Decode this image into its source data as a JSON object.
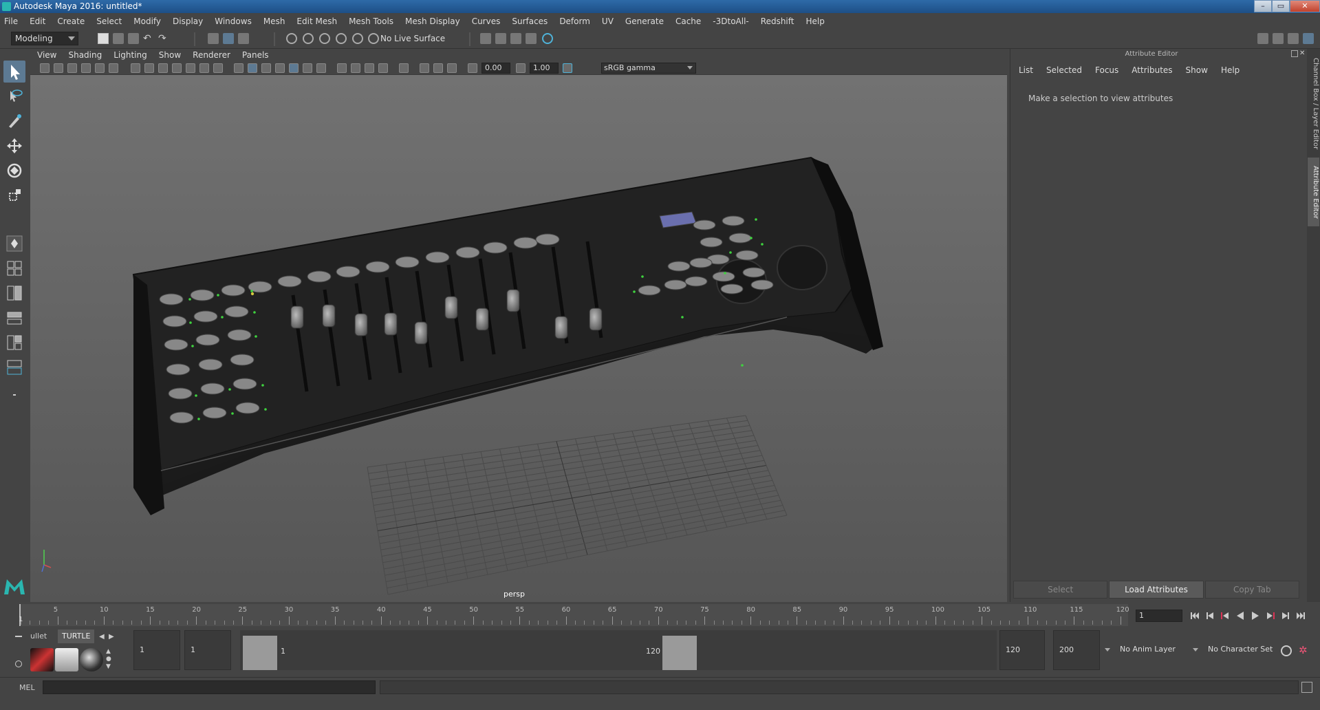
{
  "window": {
    "title": "Autodesk Maya 2016: untitled*"
  },
  "menubar": [
    "File",
    "Edit",
    "Create",
    "Select",
    "Modify",
    "Display",
    "Windows",
    "Mesh",
    "Edit Mesh",
    "Mesh Tools",
    "Mesh Display",
    "Curves",
    "Surfaces",
    "Deform",
    "UV",
    "Generate",
    "Cache",
    "-3DtoAll-",
    "Redshift",
    "Help"
  ],
  "statusline": {
    "mode": "Modeling",
    "live_surface": "No Live Surface"
  },
  "panel": {
    "menus": [
      "View",
      "Shading",
      "Lighting",
      "Show",
      "Renderer",
      "Panels"
    ],
    "exposure": "0.00",
    "gamma": "1.00",
    "color_management": "sRGB gamma",
    "camera_label": "persp"
  },
  "attribute_editor": {
    "title": "Attribute Editor",
    "menus": [
      "List",
      "Selected",
      "Focus",
      "Attributes",
      "Show",
      "Help"
    ],
    "message": "Make a selection to view attributes",
    "buttons": [
      "Select",
      "Load Attributes",
      "Copy Tab"
    ]
  },
  "side_tabs": [
    "Channel Box / Layer Editor",
    "Attribute Editor"
  ],
  "time_slider": {
    "labels": [
      "5",
      "10",
      "15",
      "20",
      "25",
      "30",
      "35",
      "40",
      "45",
      "50",
      "55",
      "60",
      "65",
      "70",
      "75",
      "80",
      "85",
      "90",
      "95",
      "100",
      "105",
      "110",
      "115",
      "120"
    ],
    "start_label": "1",
    "current_frame": "1"
  },
  "shelf": {
    "tabs": [
      "ullet",
      "TURTLE"
    ]
  },
  "range_slider": {
    "start": "1",
    "playback_start": "1",
    "range_start_label": "1",
    "range_end_label": "120",
    "playback_end": "120",
    "end": "200",
    "anim_layer": "No Anim Layer",
    "character_set": "No Character Set"
  },
  "command_line": {
    "language": "MEL"
  }
}
